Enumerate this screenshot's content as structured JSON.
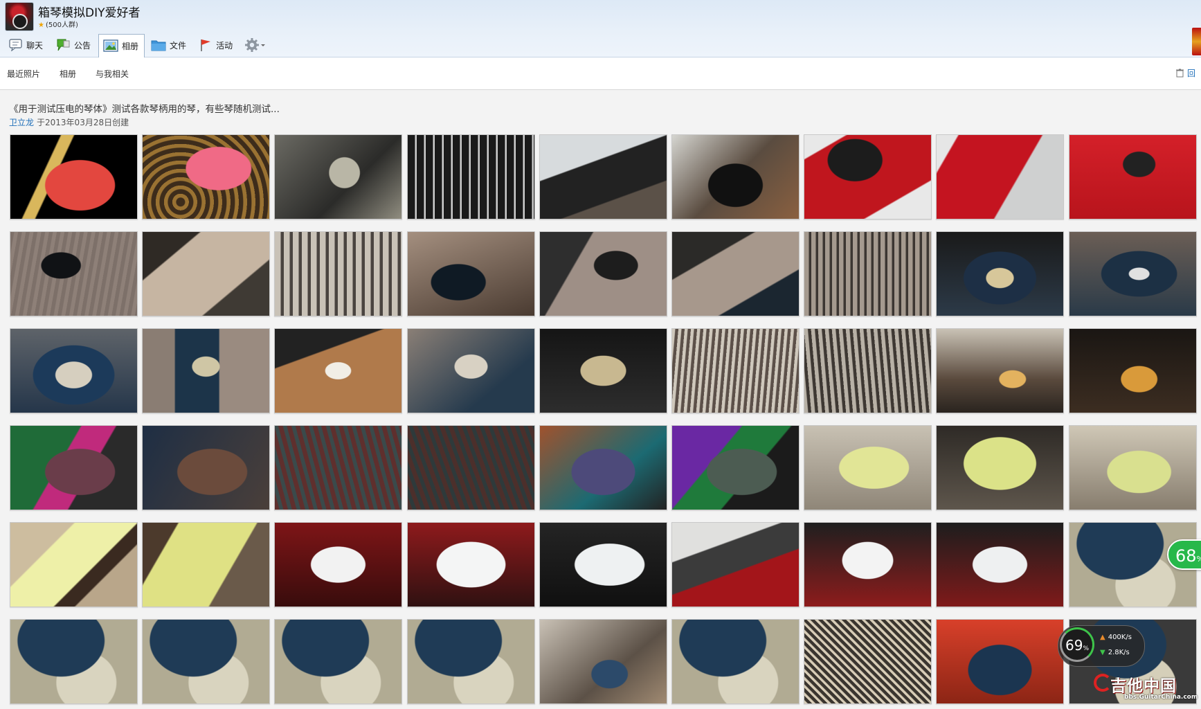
{
  "header": {
    "group_name": "箱琴模拟DIY爱好者",
    "member_count": "(500人群)",
    "toolbar": [
      {
        "label": "聊天",
        "icon": "chat-icon",
        "active": false
      },
      {
        "label": "公告",
        "icon": "announcement-icon",
        "active": false
      },
      {
        "label": "相册",
        "icon": "photo-icon",
        "active": true
      },
      {
        "label": "文件",
        "icon": "folder-icon",
        "active": false
      },
      {
        "label": "活动",
        "icon": "flag-icon",
        "active": false
      }
    ],
    "settings_icon": "gear-icon"
  },
  "subnav": {
    "tabs": [
      "最近照片",
      "相册",
      "与我相关"
    ],
    "back_label": "回"
  },
  "album": {
    "title": "《用于测试压电的琴体》测试各款琴柄用的琴，有些琴随机测试...",
    "author": "卫立龙",
    "created": "于2013年03月28日创建"
  },
  "photos": [
    {
      "theme": "red-guitar-black"
    },
    {
      "theme": "pink-guitar-rug"
    },
    {
      "theme": "tremolo-wired"
    },
    {
      "theme": "bridge-black"
    },
    {
      "theme": "pickup-cloth"
    },
    {
      "theme": "cavity-wires"
    },
    {
      "theme": "red-body"
    },
    {
      "theme": "red-body-fretboard"
    },
    {
      "theme": "red-closeup"
    },
    {
      "theme": "rout-wood"
    },
    {
      "theme": "unfinished-body"
    },
    {
      "theme": "floyd-bridge"
    },
    {
      "theme": "rout-cavity"
    },
    {
      "theme": "bridge-wood"
    },
    {
      "theme": "body-unfinished-2"
    },
    {
      "theme": "bridge-strings"
    },
    {
      "theme": "cavity-dark"
    },
    {
      "theme": "cavity-dark-2"
    },
    {
      "theme": "bridge-cavity"
    },
    {
      "theme": "bridge-denim"
    },
    {
      "theme": "bridge-table"
    },
    {
      "theme": "bridge-plate"
    },
    {
      "theme": "bridge-top"
    },
    {
      "theme": "bridge-strings-2"
    },
    {
      "theme": "bridge-strings-3"
    },
    {
      "theme": "guitar-room"
    },
    {
      "theme": "guitar-room-2"
    },
    {
      "theme": "flame-pink"
    },
    {
      "theme": "flame-brown"
    },
    {
      "theme": "flame-close"
    },
    {
      "theme": "flame-close-2"
    },
    {
      "theme": "flame-blue"
    },
    {
      "theme": "flame-green"
    },
    {
      "theme": "cream-body"
    },
    {
      "theme": "cream-body-2"
    },
    {
      "theme": "cream-body-3"
    },
    {
      "theme": "cream-neck"
    },
    {
      "theme": "cream-strat"
    },
    {
      "theme": "white-red"
    },
    {
      "theme": "white-red-2"
    },
    {
      "theme": "white-dark"
    },
    {
      "theme": "white-workbench"
    },
    {
      "theme": "white-red-3"
    },
    {
      "theme": "white-red-4"
    },
    {
      "theme": "blue-carpet"
    },
    {
      "theme": "blue-carpet"
    },
    {
      "theme": "blue-carpet"
    },
    {
      "theme": "blue-carpet"
    },
    {
      "theme": "blue-carpet"
    },
    {
      "theme": "messy-bench"
    },
    {
      "theme": "blue-carpet"
    },
    {
      "theme": "parts-bench"
    },
    {
      "theme": "blue-red"
    },
    {
      "theme": "blue-carpet-2"
    }
  ],
  "overlays": {
    "badge_percent": "68",
    "badge_unit": "%",
    "speed_percent": "69",
    "speed_unit": "%",
    "upload_speed": "400",
    "upload_unit": "K/s",
    "download_speed": "2.8",
    "download_unit": "K/s",
    "watermark_text": "吉他中国",
    "watermark_url": "bbs.GuitarChina.com"
  }
}
